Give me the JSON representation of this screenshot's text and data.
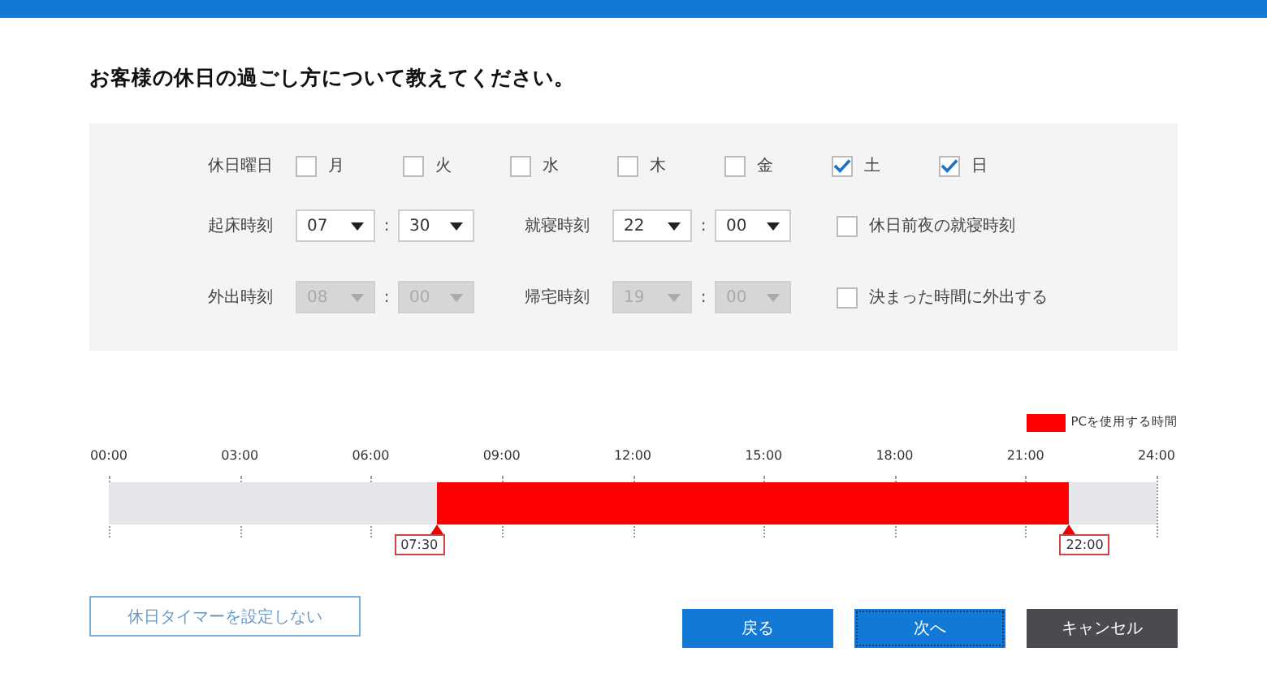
{
  "title": "お客様の休日の過ごし方について教えてください。",
  "holidays": {
    "label": "休日曜日",
    "days": [
      {
        "label": "月",
        "checked": false
      },
      {
        "label": "火",
        "checked": false
      },
      {
        "label": "水",
        "checked": false
      },
      {
        "label": "木",
        "checked": false
      },
      {
        "label": "金",
        "checked": false
      },
      {
        "label": "土",
        "checked": true
      },
      {
        "label": "日",
        "checked": true
      }
    ]
  },
  "time_rows": [
    {
      "times": [
        {
          "label": "起床時刻",
          "hour": "07",
          "separator": ":",
          "minute": "30",
          "disabled": false
        },
        {
          "label": "就寝時刻",
          "hour": "22",
          "separator": ":",
          "minute": "00",
          "disabled": false
        }
      ],
      "option": {
        "label": "休日前夜の就寝時刻",
        "checked": false
      }
    },
    {
      "times": [
        {
          "label": "外出時刻",
          "hour": "08",
          "separator": ":",
          "minute": "00",
          "disabled": true
        },
        {
          "label": "帰宅時刻",
          "hour": "19",
          "separator": ":",
          "minute": "00",
          "disabled": true
        }
      ],
      "option": {
        "label": "決まった時間に外出する",
        "checked": false
      }
    }
  ],
  "timeline": {
    "legend": "PCを使用する時間",
    "ticks": [
      "00:00",
      "03:00",
      "06:00",
      "09:00",
      "12:00",
      "15:00",
      "18:00",
      "21:00",
      "24:00"
    ],
    "start": "07:30",
    "end": "22:00"
  },
  "no_timer_button": "休日タイマーを設定しない",
  "buttons": [
    {
      "label": "戻る",
      "kind": "primary",
      "focused": false
    },
    {
      "label": "次へ",
      "kind": "primary",
      "focused": true
    },
    {
      "label": "キャンセル",
      "kind": "secondary",
      "focused": false
    }
  ]
}
